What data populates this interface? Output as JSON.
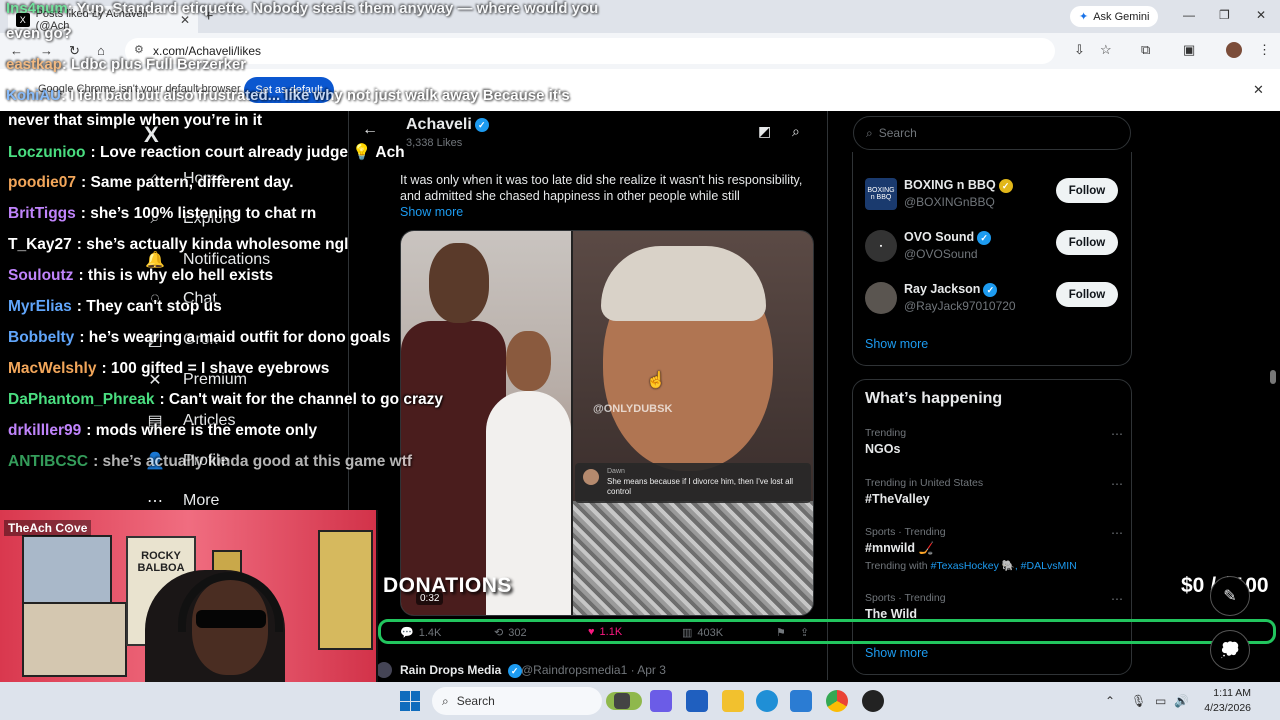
{
  "browser": {
    "tab_title": "Posts liked by Achaveli (@Ach",
    "tab_logo": "X",
    "new_tab": "+",
    "ask_gemini": "Ask Gemini",
    "url": "x.com/Achaveli/likes",
    "infobar_text": "Google Chrome isn't your default browser",
    "infobar_button": "Set as default"
  },
  "x": {
    "logo": "X",
    "nav": [
      {
        "label": "Home",
        "icon": "home-icon",
        "glyph": "⌂"
      },
      {
        "label": "Explore",
        "icon": "explore-icon",
        "glyph": "⌕"
      },
      {
        "label": "Notifications",
        "icon": "bell-icon",
        "glyph": "🔔"
      },
      {
        "label": "Chat",
        "icon": "chat-icon",
        "glyph": "◌"
      },
      {
        "label": "Grok",
        "icon": "grok-icon",
        "glyph": "◩"
      },
      {
        "label": "Premium",
        "icon": "premium-icon",
        "glyph": "✕"
      },
      {
        "label": "Articles",
        "icon": "articles-icon",
        "glyph": "▤"
      },
      {
        "label": "Profile",
        "icon": "profile-icon",
        "glyph": "👤"
      },
      {
        "label": "More",
        "icon": "more-icon",
        "glyph": "⋯"
      }
    ],
    "profile": {
      "name": "Achaveli",
      "likes": "3,338 Likes"
    },
    "tweet": {
      "text": "It was only when it was too late did she realize it wasn't his responsibility, and admitted she chased happiness in other people while still",
      "show_more": "Show more",
      "watermark": "@ONLYDUBSK",
      "caption_name": "Dawn",
      "caption_text": "She means because if I divorce him, then I've lost all control",
      "video_time": "0:32",
      "replies": "1.4K",
      "reposts": "302",
      "likes": "1.1K",
      "views": "403K"
    },
    "next_tweet": {
      "name": "Rain Drops Media",
      "handle": "@Raindropsmedia1 · Apr 3"
    },
    "search_placeholder": "Search",
    "who_to_follow": [
      {
        "name": "BOXING n BBQ",
        "handle": "@BOXINGnBBQ",
        "button": "Follow",
        "avatar_text": "BOXING n BBQ",
        "badge": "gold"
      },
      {
        "name": "OVO Sound",
        "handle": "@OVOSound",
        "button": "Follow",
        "avatar_text": "▪",
        "badge": "blue"
      },
      {
        "name": "Ray Jackson",
        "handle": "@RayJack97010720",
        "button": "Follow",
        "avatar_text": "",
        "badge": "blue"
      }
    ],
    "show_more_follow": "Show more",
    "whats_happening": "What’s happening",
    "trends": [
      {
        "meta": "Trending",
        "name": "NGOs",
        "with": ""
      },
      {
        "meta": "Trending in United States",
        "name": "#TheValley",
        "with": ""
      },
      {
        "meta": "Sports · Trending",
        "name": "#mnwild 🏒",
        "with_prefix": "Trending with",
        "with_tags": "#TexasHockey 🐘, #DALvsMIN"
      },
      {
        "meta": "Sports · Trending",
        "name": "The Wild",
        "with": ""
      }
    ],
    "show_more_trends": "Show more"
  },
  "overlay": {
    "top_chat": [
      {
        "user": "Ins4num",
        "msg": ": Yup. Standard etiquette. Nobody steals them anyway — where would you"
      },
      {
        "user": "",
        "msg": "even go?"
      },
      {
        "user": "eastkap",
        "msg": ": Ldbc plus Full Berzerker"
      },
      {
        "user": "KohiAU",
        "msg": ": I felt bad but also frustrated... like why not just walk away Because it's"
      }
    ],
    "chat": [
      {
        "user": "",
        "msg": "never that simple when you’re in it",
        "color": "#ffffff"
      },
      {
        "user": "Loczunioo",
        "msg": ": Love reaction court already judge 💡 Ach",
        "color": "#4ade80"
      },
      {
        "user": "poodie07",
        "msg": ": Same pattern, different day.",
        "color": "#f2a65a"
      },
      {
        "user": "BritTiggs",
        "msg": ": she’s 100% listening to chat rn",
        "color": "#c084fc"
      },
      {
        "user": "T_Kay27",
        "msg": ": she’s actually kinda wholesome ngl",
        "color": "#ffffff"
      },
      {
        "user": "Souloutz",
        "msg": ": this is why elo hell exists",
        "color": "#c084fc"
      },
      {
        "user": "MyrElias",
        "msg": ": They can't stop us",
        "color": "#60a5fa"
      },
      {
        "user": "Bobbelty",
        "msg": ": he’s wearing a maid outfit for dono goals",
        "color": "#60a5fa"
      },
      {
        "user": "MacWelshly",
        "msg": ": 100 gifted = I shave eyebrows",
        "color": "#f2a65a"
      },
      {
        "user": "DaPhantom_Phreak",
        "msg": ": Can't wait for the channel to go crazy",
        "color": "#4ade80"
      },
      {
        "user": "drkilller99",
        "msg": ": mods where is the emote only",
        "color": "#c084fc"
      },
      {
        "user": "ANTIBCSC",
        "msg": ": she’s actually kinda good at this game wtf",
        "color": "#4ade80"
      }
    ],
    "webcam_label": "TheAch C⊙ve",
    "poster_text": "ROCKY BALBOA",
    "donations_label": "DONATIONS",
    "donations_amount": "$0 / $100",
    "donation_progress": 0
  },
  "taskbar": {
    "search": "Search",
    "time": "1:11 AM",
    "date": "4/23/2026"
  }
}
